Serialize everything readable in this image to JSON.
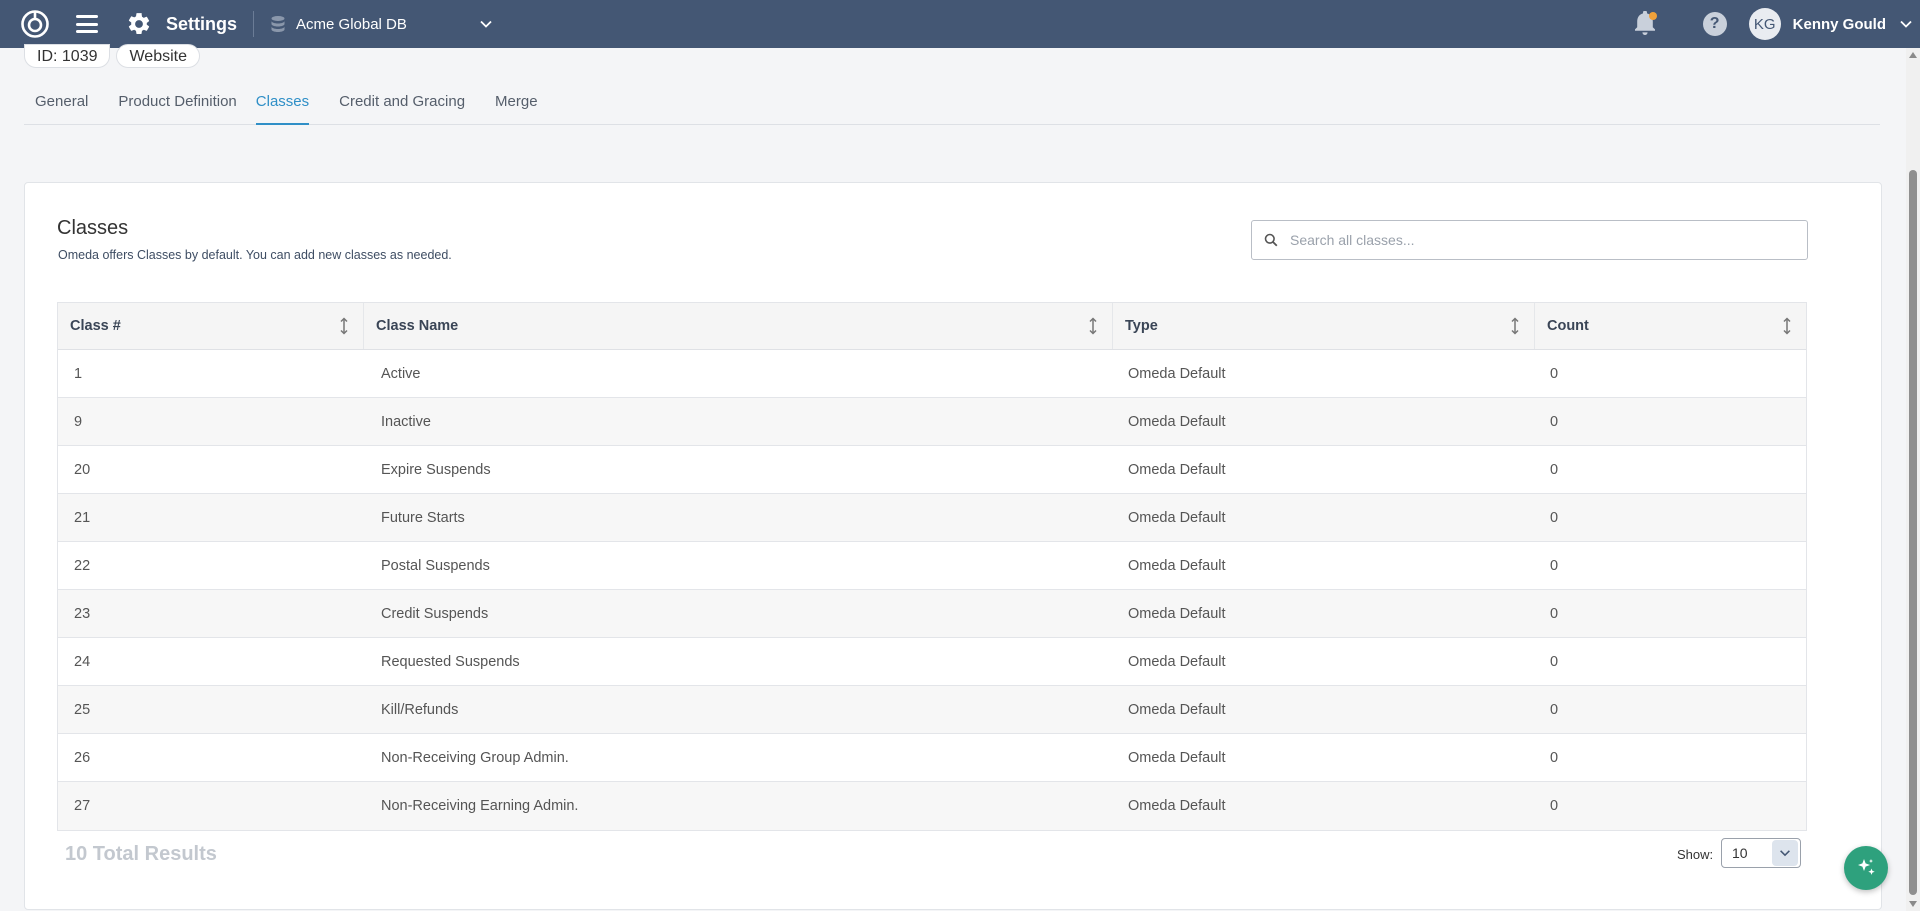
{
  "topbar": {
    "logo_icon": "app-logo-icon",
    "menu_icon": "hamburger-menu-icon",
    "settings_icon": "gear-icon",
    "title": "Settings",
    "database": "Acme Global DB",
    "user_initials": "KG",
    "user_name": "Kenny Gould",
    "notification_badge_color": "#f0a13a",
    "bar_color": "#445774"
  },
  "header": {
    "chips": [
      "ID: 1039",
      "Website"
    ],
    "tabs": [
      "General",
      "Product Definition",
      "Classes",
      "Credit and Gracing",
      "Merge"
    ],
    "active_tab": "Classes",
    "accent_color": "#2f8fc7"
  },
  "card": {
    "title": "Classes",
    "subtitle": "Omeda offers Classes by default. You can add new classes as needed.",
    "search_placeholder": "Search all classes..."
  },
  "table": {
    "columns": [
      "Class #",
      "Class Name",
      "Type",
      "Count"
    ],
    "rows": [
      {
        "num": "1",
        "name": "Active",
        "type": "Omeda Default",
        "count": "0"
      },
      {
        "num": "9",
        "name": "Inactive",
        "type": "Omeda Default",
        "count": "0"
      },
      {
        "num": "20",
        "name": "Expire Suspends",
        "type": "Omeda Default",
        "count": "0"
      },
      {
        "num": "21",
        "name": "Future Starts",
        "type": "Omeda Default",
        "count": "0"
      },
      {
        "num": "22",
        "name": "Postal Suspends",
        "type": "Omeda Default",
        "count": "0"
      },
      {
        "num": "23",
        "name": "Credit Suspends",
        "type": "Omeda Default",
        "count": "0"
      },
      {
        "num": "24",
        "name": "Requested Suspends",
        "type": "Omeda Default",
        "count": "0"
      },
      {
        "num": "25",
        "name": "Kill/Refunds",
        "type": "Omeda Default",
        "count": "0"
      },
      {
        "num": "26",
        "name": "Non-Receiving Group Admin.",
        "type": "Omeda Default",
        "count": "0"
      },
      {
        "num": "27",
        "name": "Non-Receiving Earning Admin.",
        "type": "Omeda Default",
        "count": "0"
      }
    ]
  },
  "footer": {
    "total_results": "10 Total Results",
    "show_label": "Show:",
    "page_size": "10"
  },
  "fab": {
    "icon": "sparkle-icon",
    "color": "#2ea17d"
  }
}
